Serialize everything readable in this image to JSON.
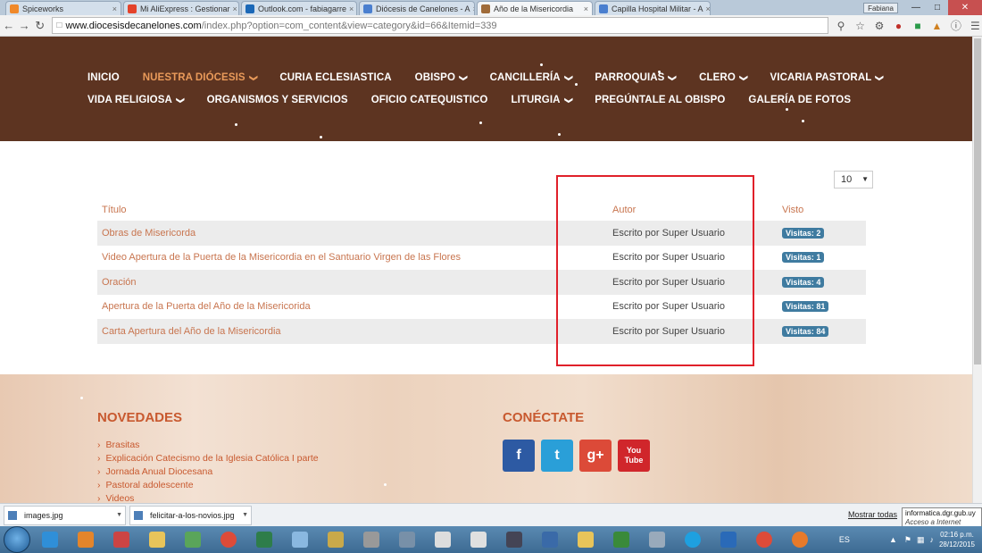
{
  "browser": {
    "tabs": [
      {
        "label": "Spiceworks",
        "color": "#f0892a"
      },
      {
        "label": "Mi AliExpress : Gestionar",
        "color": "#e4432b"
      },
      {
        "label": "Outlook.com - fabiagarre",
        "color": "#1b68b7"
      },
      {
        "label": "Diócesis de Canelones - A",
        "color": "#4a7fcf"
      },
      {
        "label": "Año de la Misericordia",
        "color": "#a06c3a",
        "active": true
      },
      {
        "label": "Capilla Hospital Militar - A",
        "color": "#4a7fcf"
      }
    ],
    "user": "Fabiana",
    "url_host": "www.diocesisdecanelones.com",
    "url_path": "/index.php?option=com_content&view=category&id=66&Itemid=339"
  },
  "nav": {
    "row1": [
      {
        "label": "INICIO",
        "dropdown": false
      },
      {
        "label": "NUESTRA DIÓCESIS",
        "dropdown": true,
        "current": true
      },
      {
        "label": "CURIA ECLESIASTICA",
        "dropdown": false
      },
      {
        "label": "OBISPO",
        "dropdown": true
      },
      {
        "label": "CANCILLERÍA",
        "dropdown": true
      },
      {
        "label": "PARROQUIAS",
        "dropdown": true
      },
      {
        "label": "CLERO",
        "dropdown": true
      },
      {
        "label": "VICARIA PASTORAL",
        "dropdown": true
      }
    ],
    "row2": [
      {
        "label": "VIDA RELIGIOSA",
        "dropdown": true
      },
      {
        "label": "ORGANISMOS Y SERVICIOS",
        "dropdown": false
      },
      {
        "label": "OFICIO CATEQUISTICO",
        "dropdown": false
      },
      {
        "label": "LITURGIA",
        "dropdown": true
      },
      {
        "label": "PREGÚNTALE AL OBISPO",
        "dropdown": false
      },
      {
        "label": "GALERÍA DE FOTOS",
        "dropdown": false
      }
    ]
  },
  "list": {
    "limit": "10",
    "headers": {
      "title": "Título",
      "author": "Autor",
      "hits": "Visto"
    },
    "rows": [
      {
        "title": "Obras de Misericorda",
        "author": "Escrito por Super Usuario",
        "hits": "Visitas: 2"
      },
      {
        "title": "Video Apertura de la Puerta de la Misericordia en el Santuario Virgen de las Flores",
        "author": "Escrito por Super Usuario",
        "hits": "Visitas: 1"
      },
      {
        "title": "Oración",
        "author": "Escrito por Super Usuario",
        "hits": "Visitas: 4"
      },
      {
        "title": "Apertura de la Puerta del Año de la Misericorida",
        "author": "Escrito por Super Usuario",
        "hits": "Visitas: 81"
      },
      {
        "title": "Carta Apertura del Año de la Misericordia",
        "author": "Escrito por Super Usuario",
        "hits": "Visitas: 84"
      }
    ]
  },
  "footer": {
    "news_title": "NOVEDADES",
    "news": [
      "Brasitas",
      "Explicación Catecismo de la Iglesia Católica I parte",
      "Jornada Anual Diocesana",
      "Pastoral adolescente",
      "Videos"
    ],
    "connect_title": "CONÉCTATE",
    "social": [
      {
        "icon": "f",
        "name": "facebook-icon",
        "color": "#2d5aa3"
      },
      {
        "icon": "t",
        "name": "twitter-icon",
        "color": "#2a9fd8"
      },
      {
        "icon": "g+",
        "name": "google-plus-icon",
        "color": "#dc4a38"
      },
      {
        "icon": "You\nTube",
        "name": "youtube-icon",
        "color": "#d0262b"
      }
    ]
  },
  "downloads": {
    "items": [
      "images.jpg",
      "felicitar-a-los-novios.jpg"
    ],
    "show_all": "Mostrar todas"
  },
  "tooltip": {
    "line1": "informatica.dgr.gub.uy",
    "line2": "Acceso a Internet"
  },
  "tray": {
    "lang": "ES",
    "time": "02:16 p.m.",
    "date": "28/12/2015"
  },
  "colors": {
    "header_bg": "#5d3421",
    "accent": "#c8754f",
    "badge": "#3f7ba0",
    "highlight_box": "#e0202a"
  }
}
